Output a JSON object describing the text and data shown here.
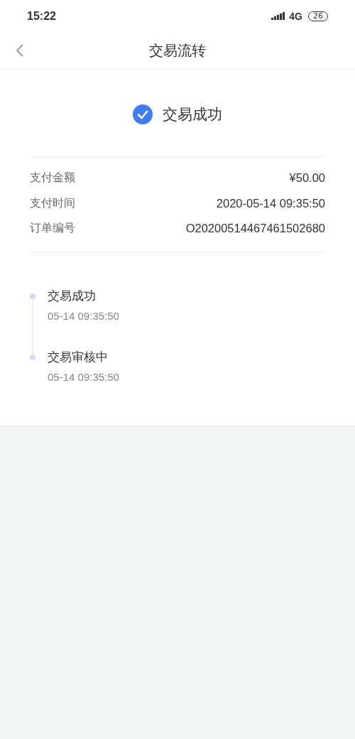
{
  "status_bar": {
    "time": "15:22",
    "network": "4G",
    "battery": "26"
  },
  "header": {
    "title": "交易流转"
  },
  "result": {
    "text": "交易成功"
  },
  "details": [
    {
      "label": "支付金额",
      "value": "¥50.00"
    },
    {
      "label": "支付时间",
      "value": "2020-05-14 09:35:50"
    },
    {
      "label": "订单编号",
      "value": "O20200514467461502680"
    }
  ],
  "timeline": [
    {
      "title": "交易成功",
      "time": "05-14 09:35:50"
    },
    {
      "title": "交易审核中",
      "time": "05-14 09:35:50"
    }
  ]
}
